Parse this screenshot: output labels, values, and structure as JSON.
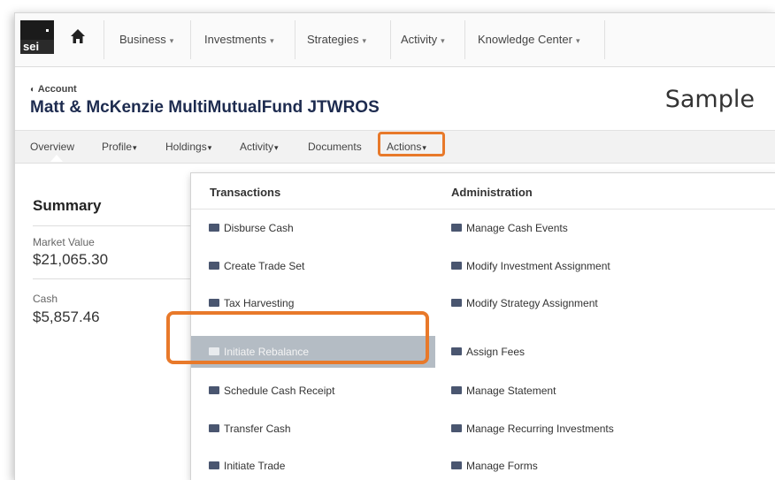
{
  "brand": {
    "logo_text": "sei"
  },
  "top_nav": {
    "home_icon": "home-icon",
    "items": [
      {
        "label": "Business"
      },
      {
        "label": "Investments"
      },
      {
        "label": "Strategies"
      },
      {
        "label": "Activity"
      },
      {
        "label": "Knowledge Center"
      }
    ]
  },
  "account": {
    "label": "Account",
    "name": "Matt & McKenzie MultiMutualFund JTWROS",
    "watermark": "Sample"
  },
  "sub_nav": {
    "items": [
      {
        "label": "Overview"
      },
      {
        "label": "Profile"
      },
      {
        "label": "Holdings"
      },
      {
        "label": "Activity"
      },
      {
        "label": "Documents"
      },
      {
        "label": "Actions"
      }
    ],
    "highlight_color": "#e8792a"
  },
  "summary": {
    "title": "Summary",
    "market_value_label": "Market Value",
    "market_value": "$21,065.30",
    "cash_label": "Cash",
    "cash_value": "$5,857.46"
  },
  "actions_menu": {
    "transactions": {
      "heading": "Transactions",
      "items": [
        {
          "label": "Disburse Cash"
        },
        {
          "label": "Create Trade Set"
        },
        {
          "label": "Tax Harvesting"
        },
        {
          "label": "Initiate Rebalance"
        },
        {
          "label": "Schedule Cash Receipt"
        },
        {
          "label": "Transfer Cash"
        },
        {
          "label": "Initiate Trade"
        }
      ]
    },
    "administration": {
      "heading": "Administration",
      "items": [
        {
          "label": "Manage Cash Events"
        },
        {
          "label": "Modify Investment Assignment"
        },
        {
          "label": "Modify Strategy Assignment"
        },
        {
          "label": "Assign Fees"
        },
        {
          "label": "Manage Statement"
        },
        {
          "label": "Manage Recurring Investments"
        },
        {
          "label": "Manage Forms"
        }
      ]
    },
    "selected_item": "Initiate Rebalance",
    "selected_bg": "#b4bcc4"
  }
}
